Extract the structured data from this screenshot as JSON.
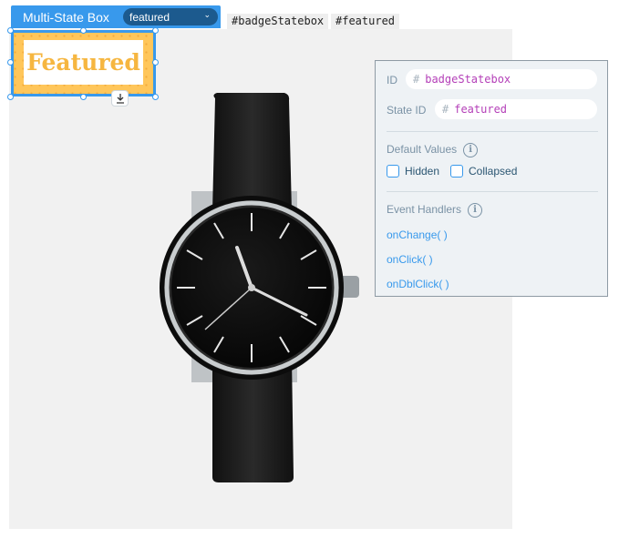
{
  "element_label": {
    "title": "Multi-State Box",
    "current_state": "featured"
  },
  "id_tags": [
    "#badgeStatebox",
    "#featured"
  ],
  "badge": {
    "text": "Featured"
  },
  "panel": {
    "id_label": "ID",
    "id_value": "badgeStatebox",
    "state_id_label": "State ID",
    "state_id_value": "featured",
    "default_values_label": "Default Values",
    "hidden_label": "Hidden",
    "collapsed_label": "Collapsed",
    "event_handlers_label": "Event Handlers",
    "handlers": [
      "onChange( )",
      "onClick( )",
      "onDblClick( )"
    ],
    "hash": "#",
    "info_glyph": "i"
  },
  "colors": {
    "accent": "#3899ec",
    "badge_bg": "#ffc65a",
    "badge_text": "#f6b640",
    "id_value": "#b43fb8"
  },
  "icons": {
    "download": "download-icon",
    "chevron": "chevron-down-icon",
    "info": "info-icon"
  }
}
